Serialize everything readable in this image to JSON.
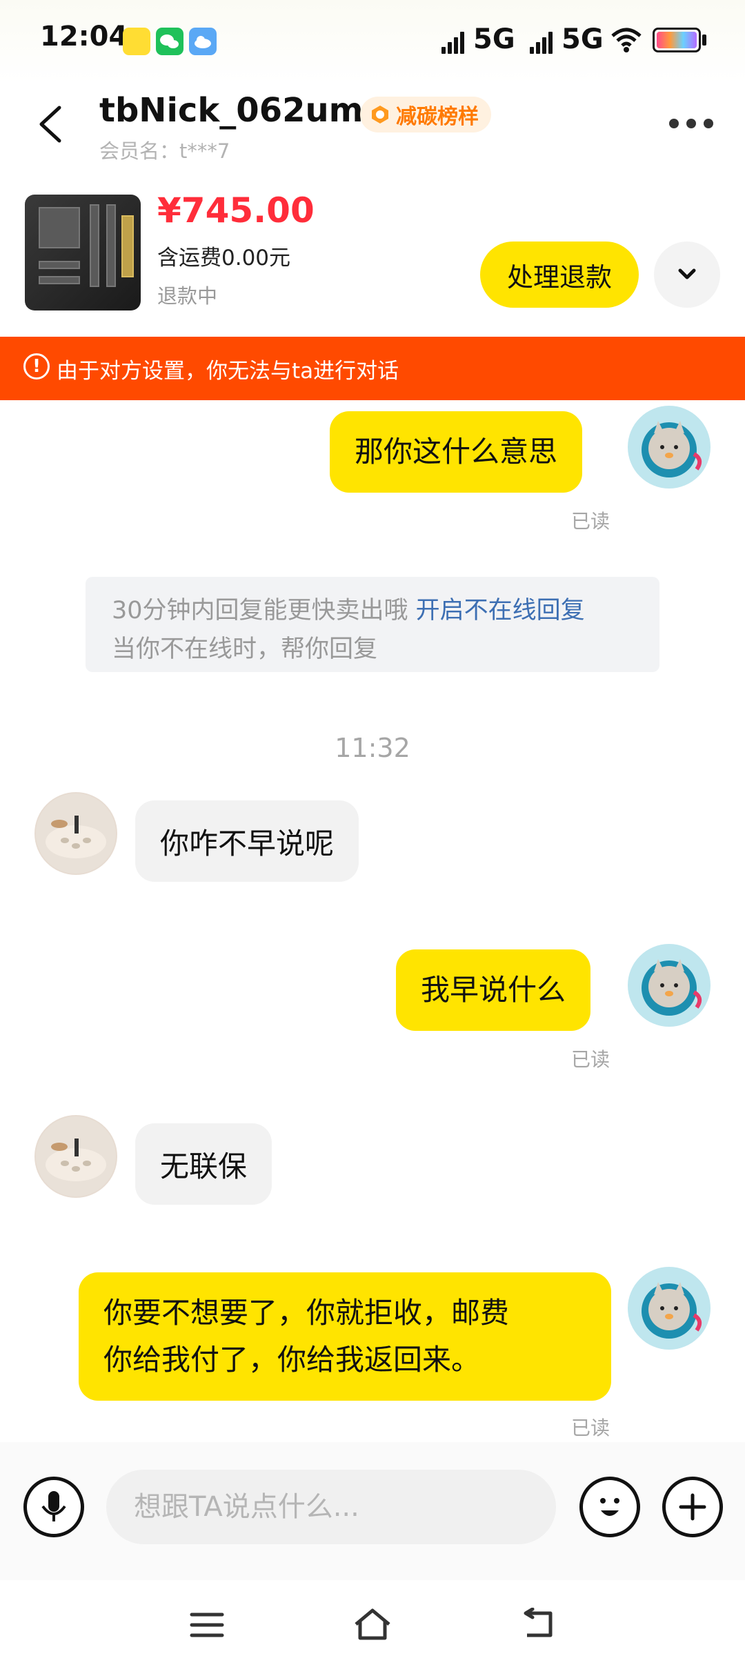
{
  "status_bar": {
    "time": "12:04",
    "network1": "5G",
    "network2": "5G",
    "icons": [
      "app-icon-yellow",
      "wechat-icon",
      "weather-icon",
      "signal-icon",
      "wifi-icon",
      "battery-icon"
    ]
  },
  "header": {
    "nickname": "tbNick_062um",
    "badge": "减碳榜样",
    "member_name": "会员名：t***7"
  },
  "product": {
    "price": "¥745.00",
    "shipping": "含运费0.00元",
    "status": "退款中",
    "action_label": "处理退款"
  },
  "warning": {
    "text": "由于对方设置，你无法与ta进行对话"
  },
  "messages": [
    {
      "from": "me",
      "text": "那你这什么意思",
      "read": "已读"
    },
    {
      "from": "other",
      "text": "你咋不早说呢"
    },
    {
      "from": "me",
      "text": "我早说什么",
      "read": "已读"
    },
    {
      "from": "other",
      "text": "无联保"
    },
    {
      "from": "me",
      "line1": "你要不想要了，你就拒收，邮费",
      "line2": "你给我付了，你给我返回来。",
      "read": "已读"
    }
  ],
  "system_notice": {
    "text": "30分钟内回复能更快卖出哦 ",
    "link": "开启不在线回复",
    "subtext": "当你不在线时，帮你回复"
  },
  "timestamp": "11:32",
  "input": {
    "placeholder": "想跟TA说点什么..."
  },
  "colors": {
    "accent_yellow": "#ffe400",
    "price_red": "#ff2d3a",
    "warning_orange": "#ff4a00",
    "link_blue": "#3d6fb3"
  }
}
